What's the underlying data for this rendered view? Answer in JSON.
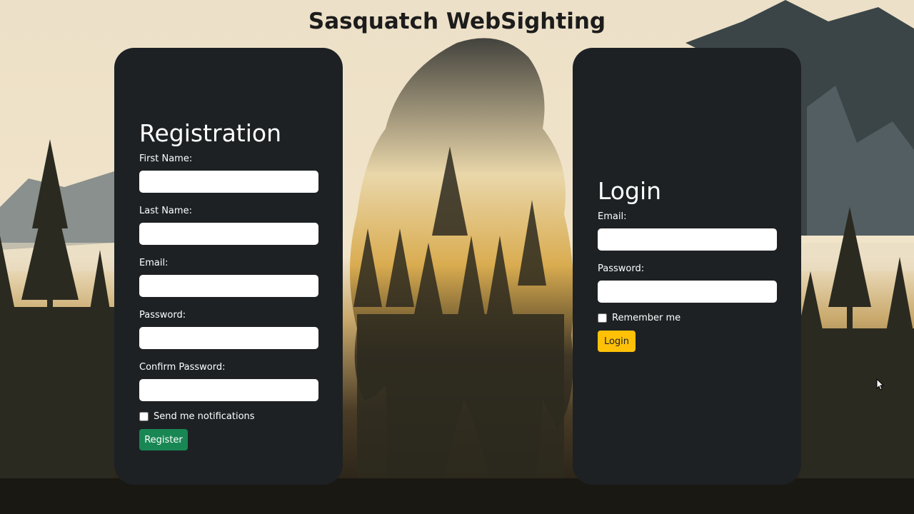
{
  "page": {
    "title": "Sasquatch WebSighting"
  },
  "registration": {
    "heading": "Registration",
    "first_name_label": "First Name:",
    "first_name_value": "",
    "last_name_label": "Last Name:",
    "last_name_value": "",
    "email_label": "Email:",
    "email_value": "",
    "password_label": "Password:",
    "password_value": "",
    "confirm_password_label": "Confirm Password:",
    "confirm_password_value": "",
    "notifications_label": "Send me notifications",
    "notifications_checked": false,
    "register_button": "Register",
    "register_button_color": "#198754"
  },
  "login": {
    "heading": "Login",
    "email_label": "Email:",
    "email_value": "",
    "password_label": "Password:",
    "password_value": "",
    "remember_label": "Remember me",
    "remember_checked": false,
    "login_button": "Login",
    "login_button_color": "#ffc107"
  },
  "colors": {
    "panel_bg": "#1d2124",
    "title_text": "#1c1c1c"
  },
  "background": {
    "description_icon": "sasquatch-forest-illustration"
  }
}
